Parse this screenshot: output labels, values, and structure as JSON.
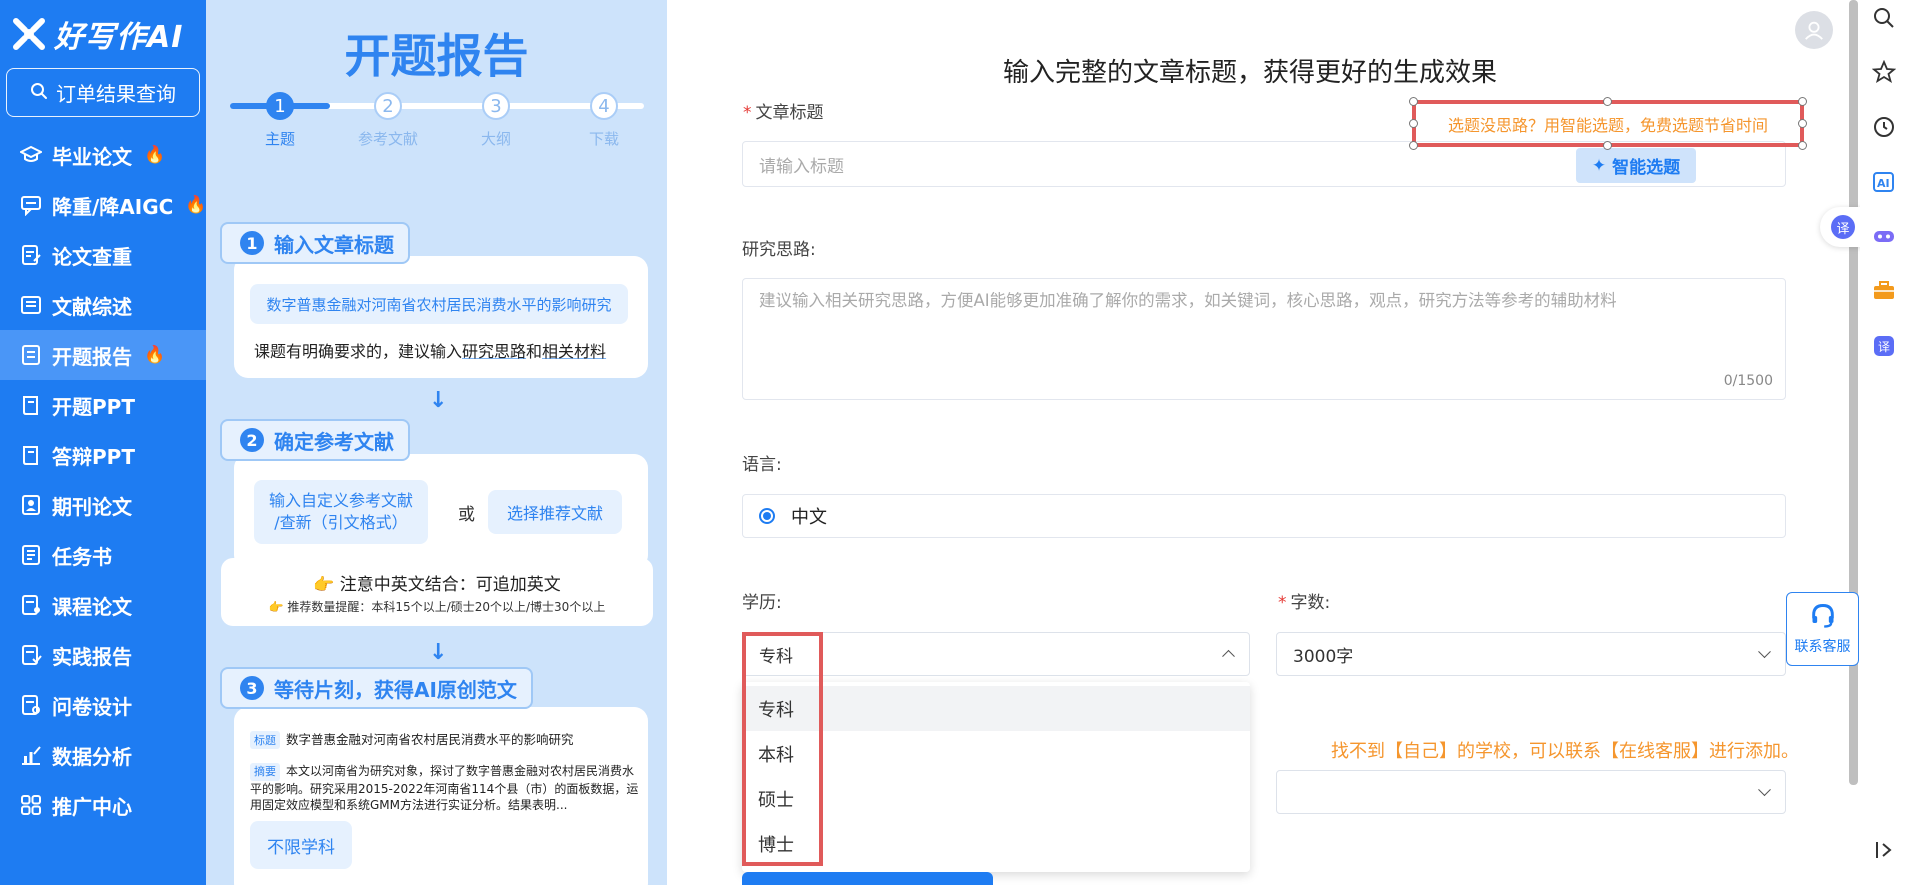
{
  "nav": {
    "logo_text": "好写作AI",
    "order_query": "订单结果查询",
    "items": [
      {
        "label": "毕业论文",
        "icon": "graduation-cap-icon",
        "hot": true
      },
      {
        "label": "降重/降AIGC",
        "icon": "chat-icon",
        "hot": true
      },
      {
        "label": "论文查重",
        "icon": "document-edit-icon",
        "hot": false
      },
      {
        "label": "文献综述",
        "icon": "list-icon",
        "hot": false
      },
      {
        "label": "开题报告",
        "icon": "report-icon",
        "hot": true,
        "active": true
      },
      {
        "label": "开题PPT",
        "icon": "book-icon",
        "hot": false
      },
      {
        "label": "答辩PPT",
        "icon": "book-icon",
        "hot": false
      },
      {
        "label": "期刊论文",
        "icon": "journal-icon",
        "hot": false
      },
      {
        "label": "任务书",
        "icon": "task-icon",
        "hot": false
      },
      {
        "label": "课程论文",
        "icon": "course-icon",
        "hot": false
      },
      {
        "label": "实践报告",
        "icon": "practice-icon",
        "hot": false
      },
      {
        "label": "问卷设计",
        "icon": "survey-icon",
        "hot": false
      },
      {
        "label": "数据分析",
        "icon": "chart-icon",
        "hot": false
      },
      {
        "label": "推广中心",
        "icon": "grid-icon",
        "hot": false
      }
    ],
    "fire": "🔥"
  },
  "guide": {
    "title": "开题报告",
    "steps": [
      {
        "num": "1",
        "label": "主题"
      },
      {
        "num": "2",
        "label": "参考文献"
      },
      {
        "num": "3",
        "label": "大纲"
      },
      {
        "num": "4",
        "label": "下载"
      }
    ],
    "step1": {
      "num": "1",
      "title": "输入文章标题",
      "example": "数字普惠金融对河南省农村居民消费水平的影响研究",
      "tip_prefix": "课题有明确要求的，建议输入",
      "tip_link1": "研究思路",
      "tip_and": "和",
      "tip_link2": "相关材料"
    },
    "step2": {
      "num": "2",
      "title": "确定参考文献",
      "custom": "输入自定义参考文献\n/查新（引文格式）",
      "or": "或",
      "recommend": "选择推荐文献",
      "note_title": "注意中英文结合：可追加英文",
      "note_sub": "推荐数量提醒：本科15个以上/硕士20个以上/博士30个以上"
    },
    "step3": {
      "num": "3",
      "title": "等待片刻，获得AI原创范文",
      "title_tag": "标题",
      "sample_title": "数字普惠金融对河南省农村居民消费水平的影响研究",
      "abstract_tag": "摘要",
      "sample_abstract": "本文以河南省为研究对象，探讨了数字普惠金融对农村居民消费水平的影响。研究采用2015-2022年河南省114个县（市）的面板数据，运用固定效应模型和系统GMM方法进行实证分析。结果表明...",
      "subject": "不限学科"
    }
  },
  "form": {
    "heading": "输入完整的文章标题，获得更好的生成效果",
    "title_label": "文章标题",
    "title_placeholder": "请输入标题",
    "smart_hint": "选题没思路？用智能选题，免费选题节省时间",
    "smart_btn": "智能选题",
    "idea_label": "研究思路:",
    "idea_placeholder": "建议输入相关研究思路，方便AI能够更加准确了解你的需求，如关键词，核心思路，观点，研究方法等参考的辅助材料",
    "idea_count": "0/1500",
    "lang_label": "语言:",
    "lang_value": "中文",
    "edu_label": "学历:",
    "edu_value": "专科",
    "edu_options": [
      "专科",
      "本科",
      "硕士",
      "博士"
    ],
    "words_label": "字数:",
    "words_value": "3000字",
    "school_note": "找不到【自己】的学校，可以联系【在线客服】进行添加。"
  },
  "side": {
    "service": "联系客服",
    "translate": "译"
  },
  "colors": {
    "brand": "#1e7cf2",
    "panel": "#cde3fb",
    "alert": "#e05a5a",
    "warn": "#f5962e"
  }
}
